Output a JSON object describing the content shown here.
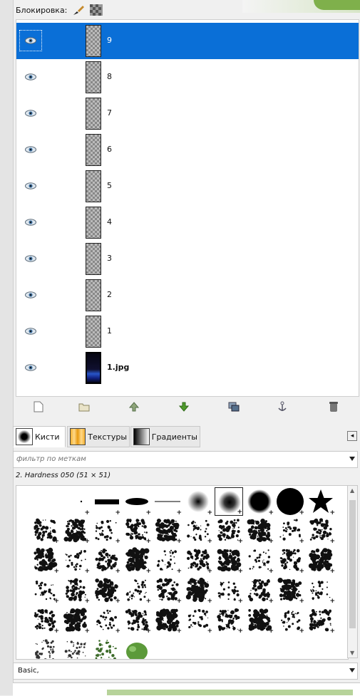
{
  "lock": {
    "label": "Блокировка:"
  },
  "layers": [
    {
      "name": "9",
      "selected": true,
      "type": "transparent"
    },
    {
      "name": "8",
      "selected": false,
      "type": "transparent"
    },
    {
      "name": "7",
      "selected": false,
      "type": "transparent"
    },
    {
      "name": "6",
      "selected": false,
      "type": "transparent"
    },
    {
      "name": "5",
      "selected": false,
      "type": "transparent"
    },
    {
      "name": "4",
      "selected": false,
      "type": "transparent"
    },
    {
      "name": "3",
      "selected": false,
      "type": "transparent"
    },
    {
      "name": "2",
      "selected": false,
      "type": "transparent"
    },
    {
      "name": "1",
      "selected": false,
      "type": "transparent"
    },
    {
      "name": "1.jpg",
      "selected": false,
      "type": "photo"
    }
  ],
  "layer_toolbar": [
    "new-layer-icon",
    "new-group-icon",
    "raise-layer-icon",
    "lower-layer-icon",
    "duplicate-layer-icon",
    "anchor-layer-icon",
    "delete-layer-icon"
  ],
  "tabs": [
    {
      "label": "Кисти",
      "active": true
    },
    {
      "label": "Текстуры",
      "active": false
    },
    {
      "label": "Градиенты",
      "active": false
    }
  ],
  "filter": {
    "placeholder": "фильтр по меткам"
  },
  "brush": {
    "current": "2. Hardness 050 (51 × 51)"
  },
  "preset": {
    "value": "Basic,"
  },
  "colors": {
    "selection": "#0a6fd7",
    "accent_green": "#7fb04b"
  }
}
